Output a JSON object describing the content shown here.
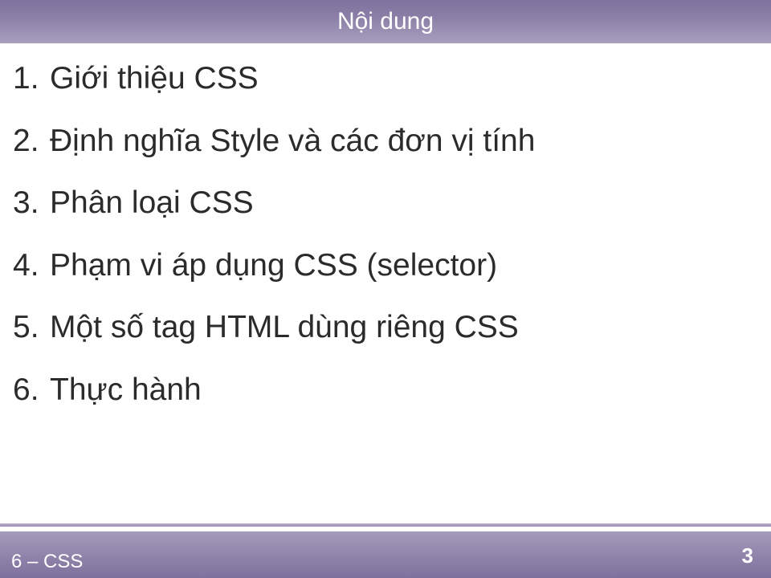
{
  "header": {
    "title": "Nội dung"
  },
  "items": [
    {
      "num": "1.",
      "text": "Giới thiệu CSS"
    },
    {
      "num": "2.",
      "text": "Định nghĩa Style và các đơn vị tính"
    },
    {
      "num": "3.",
      "text": "Phân loại CSS"
    },
    {
      "num": "4.",
      "text": "Phạm vi áp dụng CSS (selector)"
    },
    {
      "num": "5.",
      "text": "Một số tag HTML dùng riêng  CSS"
    },
    {
      "num": "6.",
      "text": "Thực hành"
    }
  ],
  "footer": {
    "left": "6 – CSS",
    "page": "3"
  }
}
